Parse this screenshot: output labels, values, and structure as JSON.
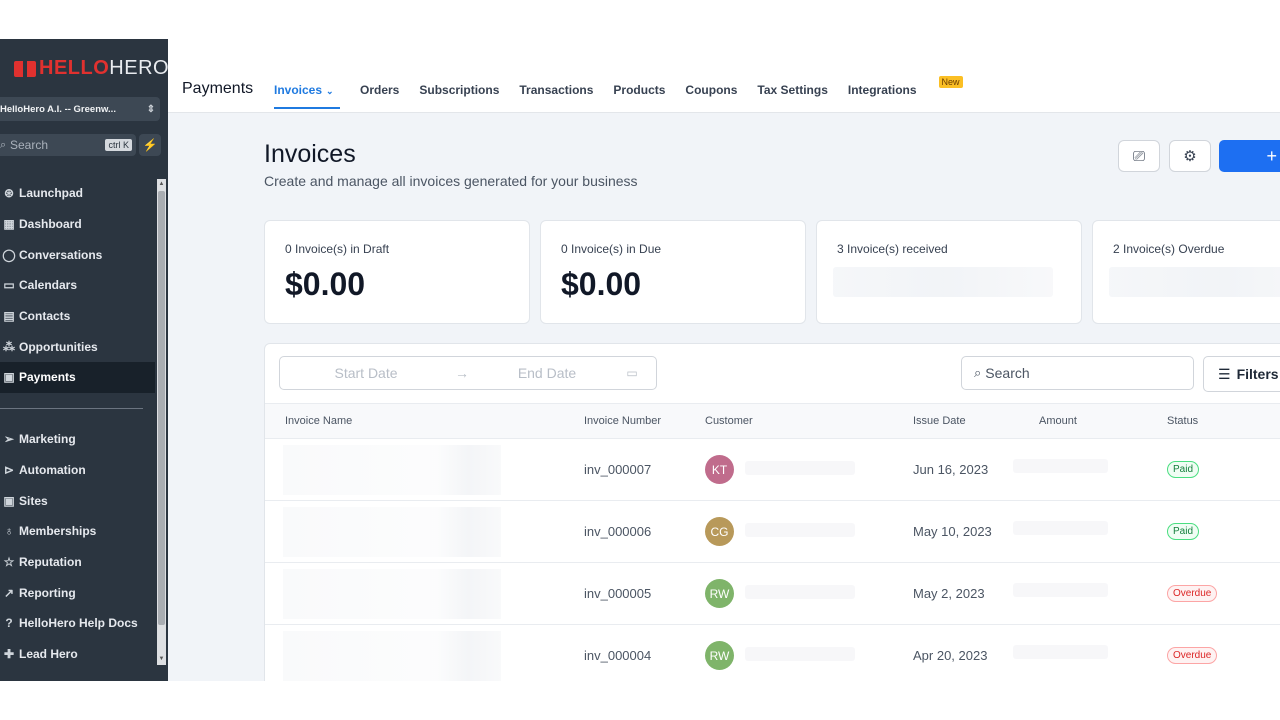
{
  "sidebar": {
    "logo_hello": "HELLO",
    "logo_hero": "HERO",
    "location": "HelloHero A.I. -- Greenw...",
    "search_placeholder": "Search",
    "search_shortcut": "ctrl K",
    "items": [
      {
        "label": "Launchpad",
        "icon": "rocket-icon",
        "glyph": "⊛"
      },
      {
        "label": "Dashboard",
        "icon": "dashboard-icon",
        "glyph": "▦"
      },
      {
        "label": "Conversations",
        "icon": "chat-icon",
        "glyph": "◯"
      },
      {
        "label": "Calendars",
        "icon": "calendar-icon",
        "glyph": "▭"
      },
      {
        "label": "Contacts",
        "icon": "contacts-icon",
        "glyph": "▤"
      },
      {
        "label": "Opportunities",
        "icon": "opportunities-icon",
        "glyph": "⁂"
      },
      {
        "label": "Payments",
        "icon": "payments-icon",
        "glyph": "▣"
      }
    ],
    "items2": [
      {
        "label": "Marketing",
        "icon": "send-icon",
        "glyph": "➢"
      },
      {
        "label": "Automation",
        "icon": "automation-icon",
        "glyph": "⊳"
      },
      {
        "label": "Sites",
        "icon": "sites-icon",
        "glyph": "▣"
      },
      {
        "label": "Memberships",
        "icon": "memberships-icon",
        "glyph": "♁"
      },
      {
        "label": "Reputation",
        "icon": "star-icon",
        "glyph": "☆"
      },
      {
        "label": "Reporting",
        "icon": "reporting-icon",
        "glyph": "↗"
      },
      {
        "label": "HelloHero Help Docs",
        "icon": "help-icon",
        "glyph": "?"
      },
      {
        "label": "Lead Hero",
        "icon": "add-user-icon",
        "glyph": "✚"
      }
    ]
  },
  "topbar": {
    "title": "Payments",
    "tabs": [
      "Invoices",
      "Orders",
      "Subscriptions",
      "Transactions",
      "Products",
      "Coupons",
      "Tax Settings",
      "Integrations"
    ],
    "new_badge": "New"
  },
  "page": {
    "title": "Invoices",
    "subtitle": "Create and manage all invoices generated for your business",
    "add_label": "+"
  },
  "cards": [
    {
      "label": "0 Invoice(s) in Draft",
      "value": "$0.00"
    },
    {
      "label": "0 Invoice(s) in Due",
      "value": "$0.00"
    },
    {
      "label": "3 Invoice(s) received",
      "value": ""
    },
    {
      "label": "2 Invoice(s) Overdue",
      "value": ""
    }
  ],
  "filters": {
    "start_date": "Start Date",
    "end_date": "End Date",
    "search": "Search",
    "filters_label": "Filters"
  },
  "table": {
    "columns": [
      "Invoice Name",
      "Invoice Number",
      "Customer",
      "Issue Date",
      "Amount",
      "Status"
    ],
    "rows": [
      {
        "number": "inv_000007",
        "initials": "KT",
        "avatar_color": "#c06c8c",
        "date": "Jun 16, 2023",
        "status": "Paid"
      },
      {
        "number": "inv_000006",
        "initials": "CG",
        "avatar_color": "#b8995a",
        "date": "May 10, 2023",
        "status": "Paid"
      },
      {
        "number": "inv_000005",
        "initials": "RW",
        "avatar_color": "#7fb46a",
        "date": "May 2, 2023",
        "status": "Overdue"
      },
      {
        "number": "inv_000004",
        "initials": "RW",
        "avatar_color": "#7fb46a",
        "date": "Apr 20, 2023",
        "status": "Overdue"
      }
    ]
  },
  "colors": {
    "sidebar_bg": "#2b3540",
    "accent_blue": "#1f7ae0",
    "brand_red": "#e0312f"
  }
}
